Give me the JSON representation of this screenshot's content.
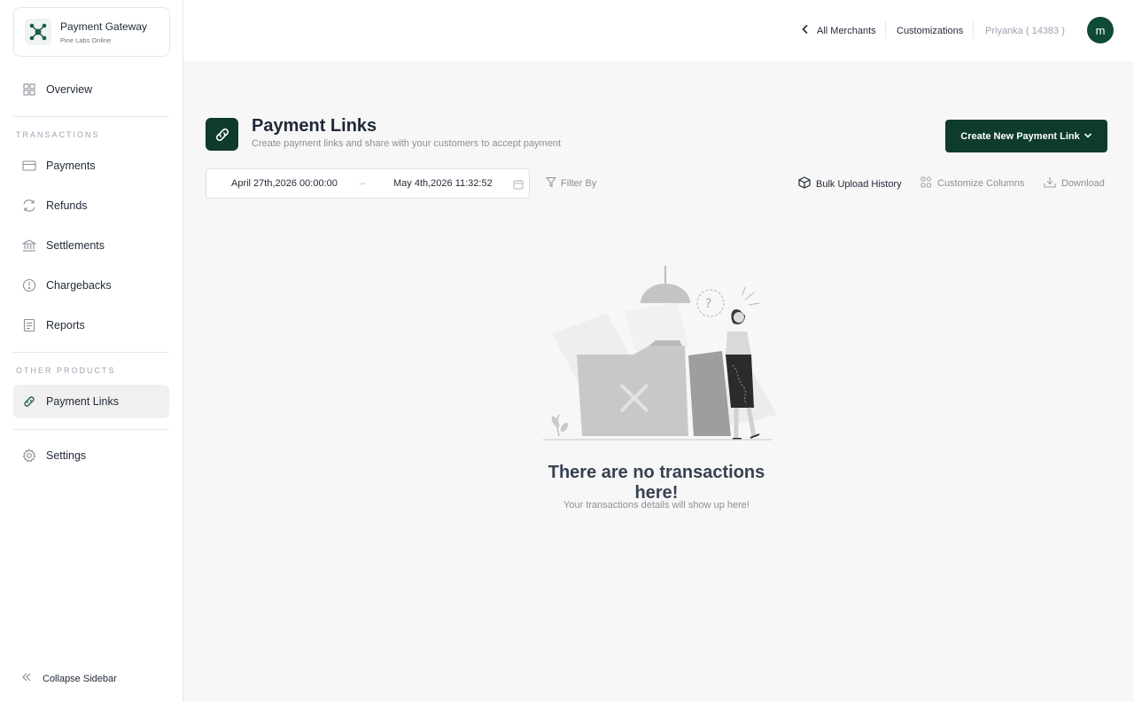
{
  "brand": {
    "title": "Payment Gateway",
    "subtitle": "Pine Labs Online"
  },
  "sidebar": {
    "overview": "Overview",
    "transactions_label": "TRANSACTIONS",
    "transactions": [
      "Payments",
      "Refunds",
      "Settlements",
      "Chargebacks",
      "Reports"
    ],
    "other_label": "OTHER PRODUCTS",
    "payment_links": "Payment Links",
    "settings": "Settings",
    "collapse": "Collapse Sidebar"
  },
  "topbar": {
    "all_merchants": "All Merchants",
    "customizations": "Customizations",
    "user": "Priyanka ( 14383 )",
    "avatar_initial": "m"
  },
  "header": {
    "title": "Payment Links",
    "subtitle": "Create payment links and share with your customers to accept payment",
    "create_button": "Create New Payment Link"
  },
  "filters": {
    "date_from": "April 27th,2026 00:00:00",
    "date_arrow": "→",
    "date_to": "May 4th,2026 11:32:52",
    "filter_by": "Filter By"
  },
  "tools": {
    "bulk_upload": "Bulk Upload History",
    "customize_columns": "Customize Columns",
    "download": "Download"
  },
  "empty": {
    "title": "There are no transactions here!",
    "subtitle": "Your transactions details will show up here!"
  },
  "colors": {
    "brand_dark": "#0e3b2b",
    "muted": "#8a8f98"
  }
}
